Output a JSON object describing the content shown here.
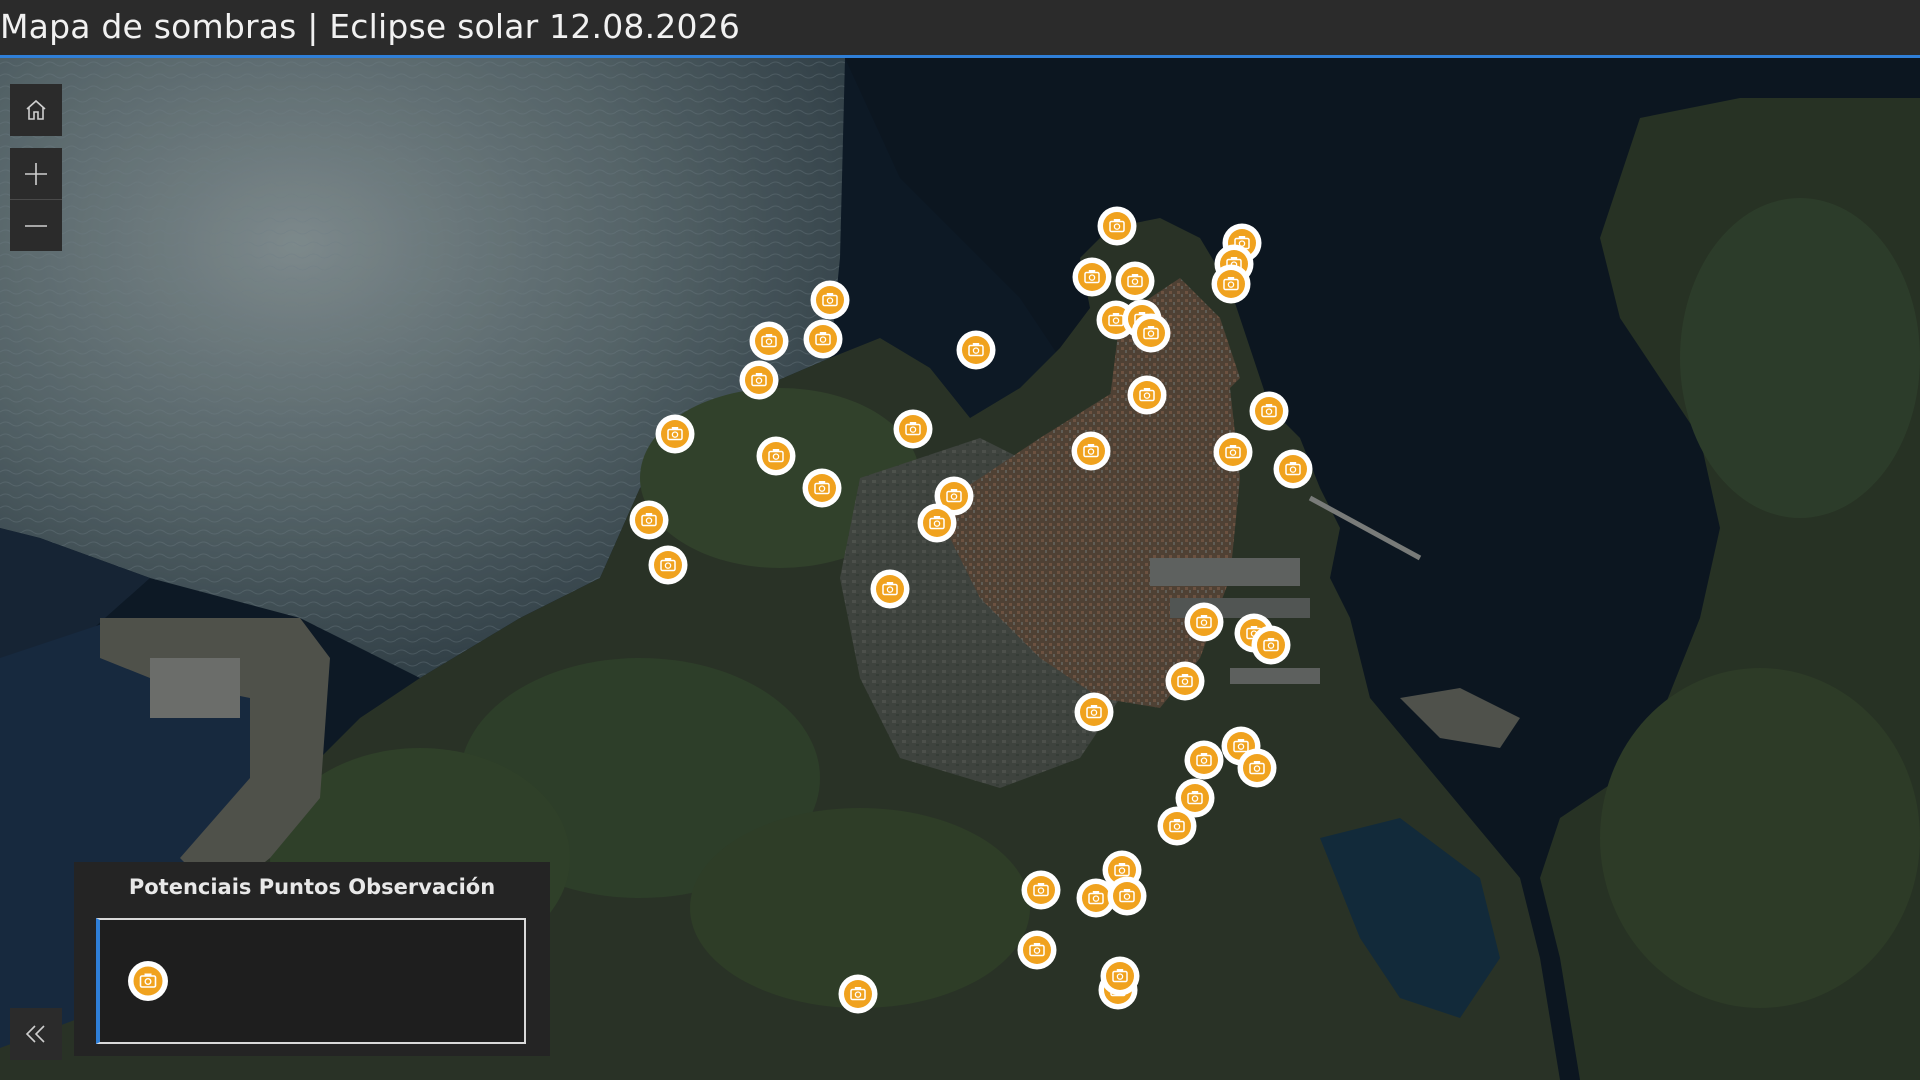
{
  "header": {
    "title": "Mapa de sombras | Eclipse solar 12.08.2026"
  },
  "map_controls": {
    "home_icon": "home-icon",
    "zoom_in_icon": "plus-icon",
    "zoom_out_icon": "minus-icon",
    "collapse_icon": "double-chevron-left-icon"
  },
  "legend": {
    "title": "Potenciais Puntos Observación",
    "symbol_icon": "camera-icon"
  },
  "marker_icon": "camera-icon",
  "colors": {
    "marker_fill": "#F0A21E",
    "marker_border": "#FFFFFF",
    "accent_blue": "#2F7FD8",
    "header_bg": "#2B2B2B",
    "panel_bg": "#242424"
  }
}
